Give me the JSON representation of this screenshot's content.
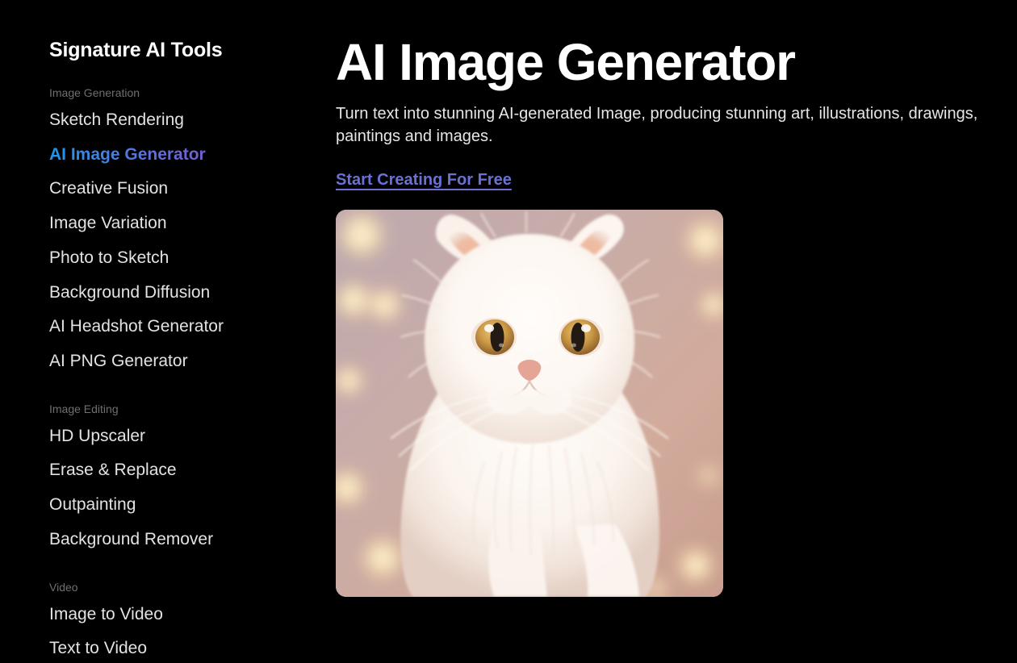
{
  "sidebar": {
    "title": "Signature AI Tools",
    "groups": [
      {
        "label": "Image Generation",
        "items": [
          {
            "label": "Sketch Rendering",
            "active": false
          },
          {
            "label": "AI Image Generator",
            "active": true
          },
          {
            "label": "Creative Fusion",
            "active": false
          },
          {
            "label": "Image Variation",
            "active": false
          },
          {
            "label": "Photo to Sketch",
            "active": false
          },
          {
            "label": "Background Diffusion",
            "active": false
          },
          {
            "label": "AI Headshot Generator",
            "active": false
          },
          {
            "label": "AI PNG Generator",
            "active": false
          }
        ]
      },
      {
        "label": "Image Editing",
        "items": [
          {
            "label": "HD Upscaler",
            "active": false
          },
          {
            "label": "Erase & Replace",
            "active": false
          },
          {
            "label": "Outpainting",
            "active": false
          },
          {
            "label": "Background Remover",
            "active": false
          }
        ]
      },
      {
        "label": "Video",
        "items": [
          {
            "label": "Image to Video",
            "active": false
          },
          {
            "label": "Text to Video",
            "active": false
          }
        ]
      }
    ]
  },
  "main": {
    "title": "AI Image Generator",
    "description": "Turn text into stunning AI-generated Image, producing stunning art, illustrations, drawings, paintings and images.",
    "cta_label": "Start Creating For Free",
    "preview": {
      "alt": "AI generated white fluffy Persian cat with amber eyes on a warm pink bokeh background"
    }
  },
  "colors": {
    "background": "#000000",
    "text_primary": "#ffffff",
    "text_secondary": "#e3e3e3",
    "text_muted": "#6f6f6f",
    "accent_link": "#6b71d4",
    "accent_gradient_start": "#1f97e8",
    "accent_gradient_end": "#7a5cd4"
  }
}
